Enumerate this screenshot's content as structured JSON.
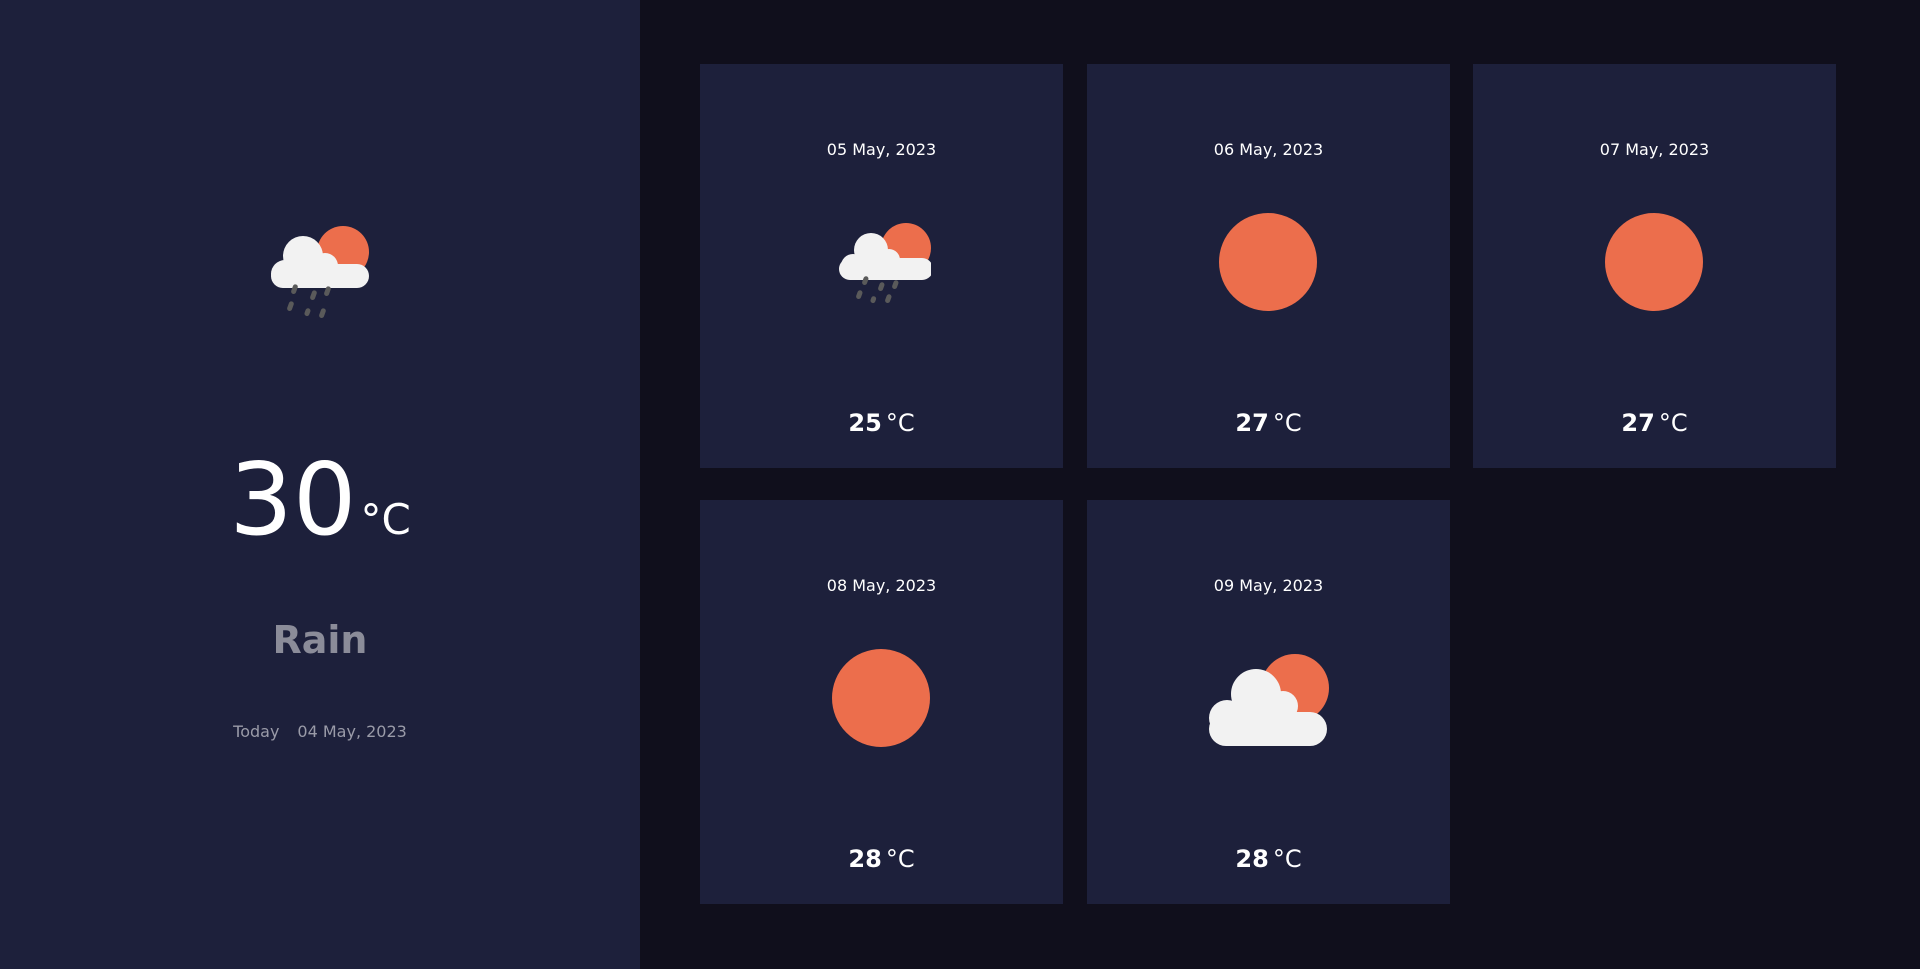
{
  "today": {
    "icon": "rain-cloud-sun-icon",
    "temperature": "30",
    "unit": "°C",
    "condition": "Rain",
    "label": "Today",
    "date": "04 May, 2023"
  },
  "forecast": [
    {
      "date": "05 May, 2023",
      "icon": "rain-cloud-sun-icon",
      "temperature": "25",
      "unit": "°C"
    },
    {
      "date": "06 May, 2023",
      "icon": "sun-icon",
      "temperature": "27",
      "unit": "°C"
    },
    {
      "date": "07 May, 2023",
      "icon": "sun-icon",
      "temperature": "27",
      "unit": "°C"
    },
    {
      "date": "08 May, 2023",
      "icon": "sun-icon",
      "temperature": "28",
      "unit": "°C"
    },
    {
      "date": "09 May, 2023",
      "icon": "partly-cloudy-icon",
      "temperature": "28",
      "unit": "°C"
    }
  ],
  "colors": {
    "sun": "#ec6e4c",
    "cloud": "#f2f2f2",
    "rain": "#5a5a5a",
    "panel": "#1d203b",
    "background": "#100f1c"
  }
}
